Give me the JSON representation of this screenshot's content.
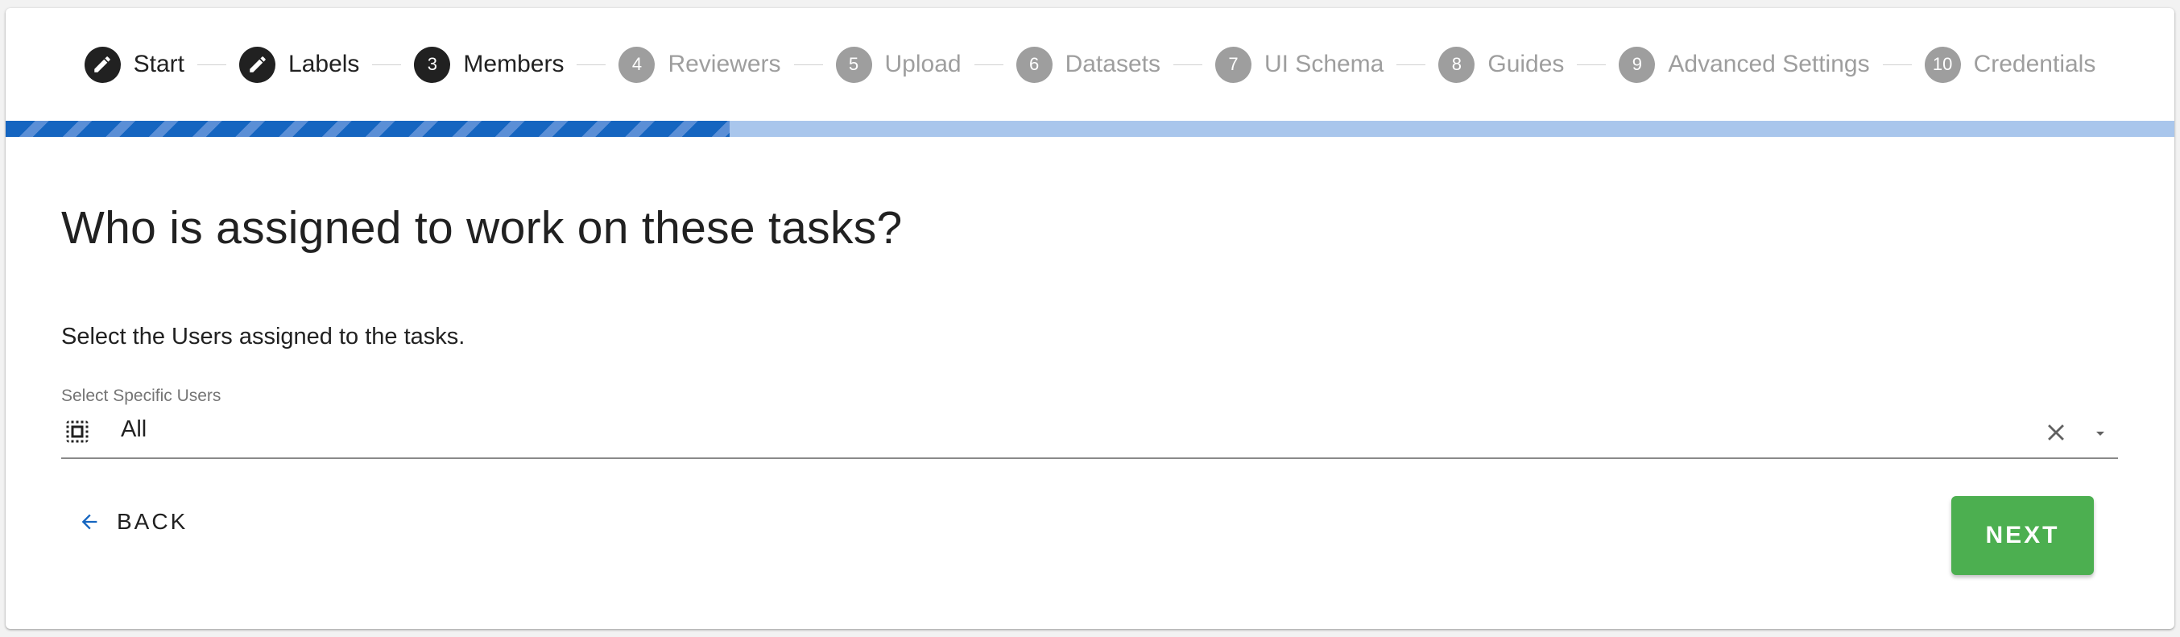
{
  "colors": {
    "active_badge": "#212121",
    "inactive_badge": "#9e9e9e",
    "progress_track": "#a9c6ec",
    "progress_fill": "#1565c0",
    "next_button": "#4caf50",
    "back_arrow": "#1565c0"
  },
  "stepper": {
    "progress_fraction": 0.334,
    "steps": [
      {
        "badge": "",
        "icon": "pencil-icon",
        "label": "Start",
        "state": "completed"
      },
      {
        "badge": "",
        "icon": "pencil-icon",
        "label": "Labels",
        "state": "completed"
      },
      {
        "badge": "3",
        "label": "Members",
        "state": "active"
      },
      {
        "badge": "4",
        "label": "Reviewers",
        "state": "inactive"
      },
      {
        "badge": "5",
        "label": "Upload",
        "state": "inactive"
      },
      {
        "badge": "6",
        "label": "Datasets",
        "state": "inactive"
      },
      {
        "badge": "7",
        "label": "UI Schema",
        "state": "inactive"
      },
      {
        "badge": "8",
        "label": "Guides",
        "state": "inactive"
      },
      {
        "badge": "9",
        "label": "Advanced Settings",
        "state": "inactive"
      },
      {
        "badge": "10",
        "label": "Credentials",
        "state": "inactive"
      }
    ]
  },
  "main": {
    "question": "Who is assigned to work on these tasks?",
    "instruction": "Select the Users assigned to the tasks.",
    "select": {
      "label": "Select Specific Users",
      "value": "All",
      "icon": "select-all-icon"
    }
  },
  "actions": {
    "back_label": "BACK",
    "next_label": "NEXT"
  }
}
